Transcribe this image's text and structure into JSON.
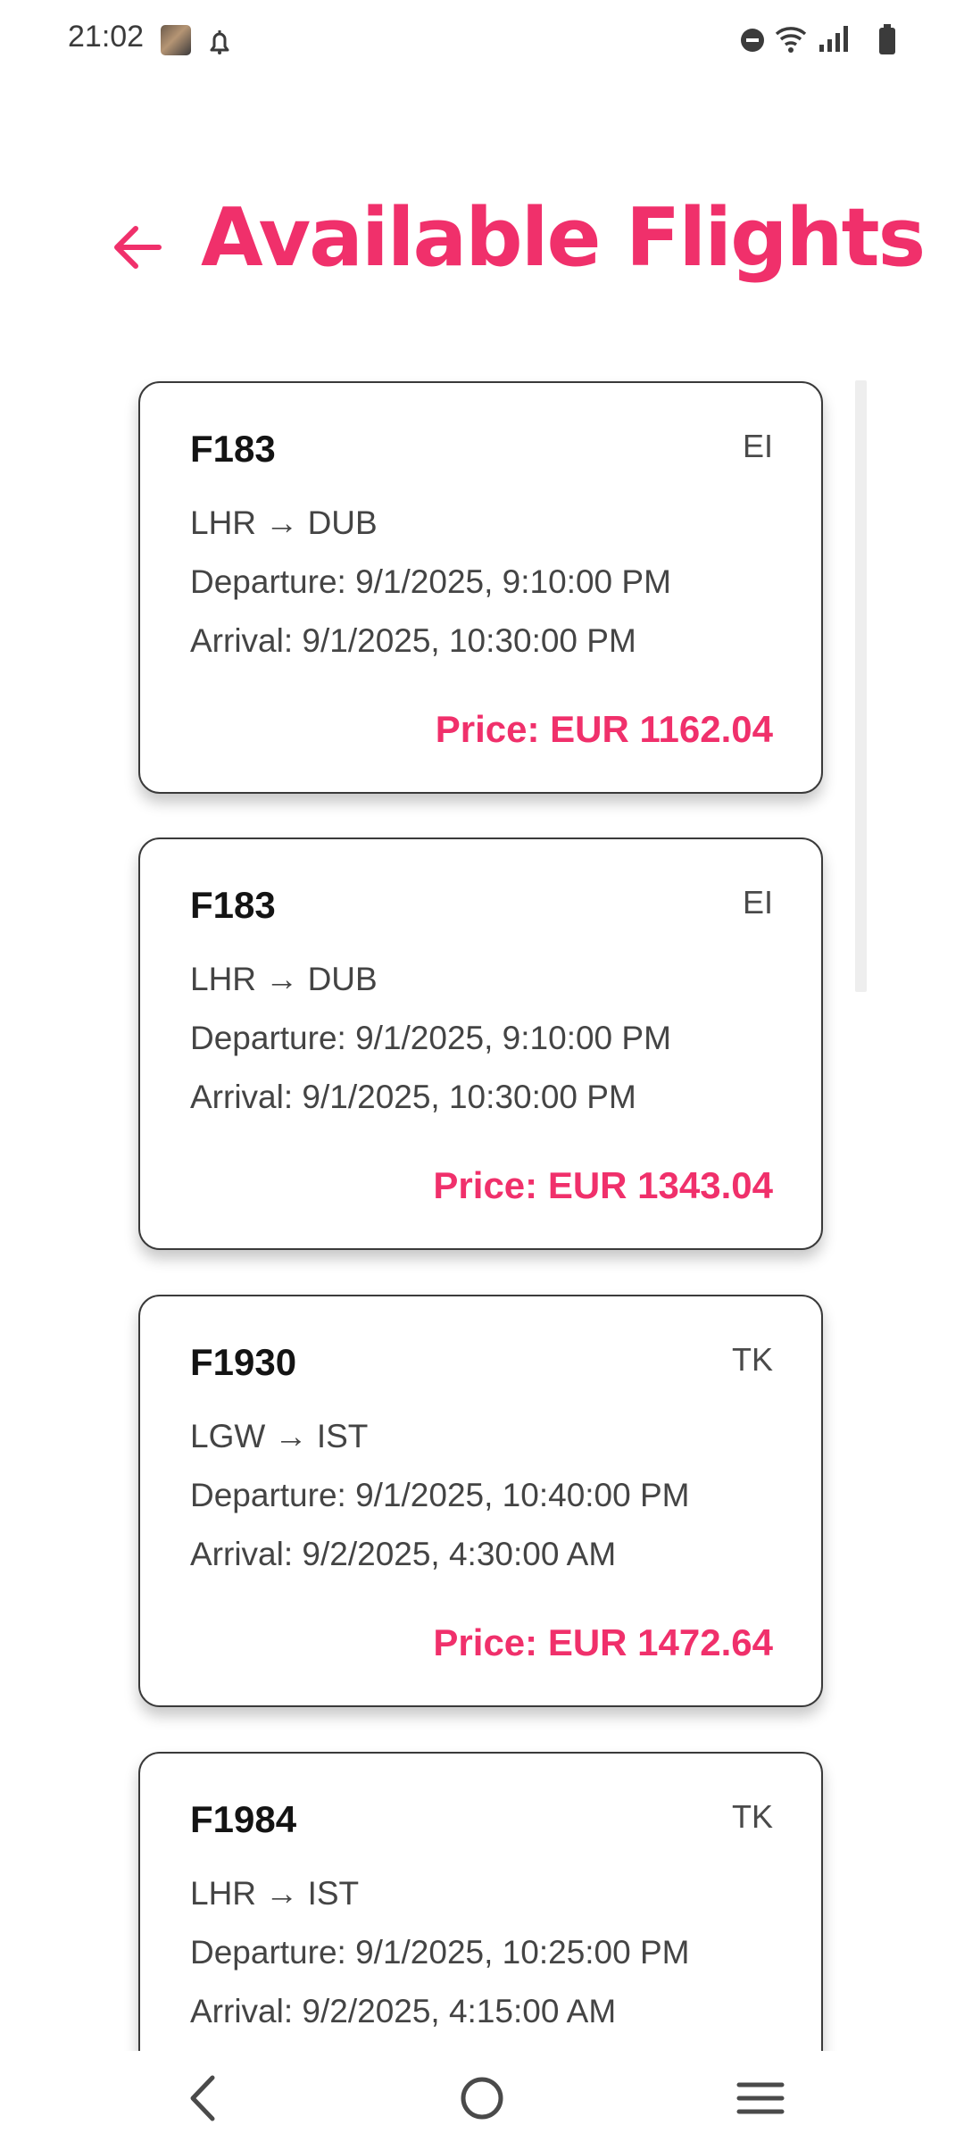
{
  "status_bar": {
    "time": "21:02",
    "icons": [
      "photo-notification-icon",
      "alarm-icon",
      "do-not-disturb-icon",
      "wifi-icon",
      "signal-icon",
      "battery-icon"
    ]
  },
  "header": {
    "back_icon": "arrow-left-icon",
    "title": "Available Flights"
  },
  "theme": {
    "accent": "#f0306b",
    "card_border": "#3a3a3a",
    "text": "#444444"
  },
  "flights": [
    {
      "flight_no": "F183",
      "airline": "EI",
      "route": "LHR → DUB",
      "departure": "Departure: 9/1/2025, 9:10:00 PM",
      "arrival": "Arrival: 9/1/2025, 10:30:00 PM",
      "price": "Price: EUR 1162.04"
    },
    {
      "flight_no": "F183",
      "airline": "EI",
      "route": "LHR → DUB",
      "departure": "Departure: 9/1/2025, 9:10:00 PM",
      "arrival": "Arrival: 9/1/2025, 10:30:00 PM",
      "price": "Price: EUR 1343.04"
    },
    {
      "flight_no": "F1930",
      "airline": "TK",
      "route": "LGW → IST",
      "departure": "Departure: 9/1/2025, 10:40:00 PM",
      "arrival": "Arrival: 9/2/2025, 4:30:00 AM",
      "price": "Price: EUR 1472.64"
    },
    {
      "flight_no": "F1984",
      "airline": "TK",
      "route": "LHR → IST",
      "departure": "Departure: 9/1/2025, 10:25:00 PM",
      "arrival": "Arrival: 9/2/2025, 4:15:00 AM",
      "price": ""
    }
  ],
  "nav_bar": {
    "icons": [
      "back-chevron-icon",
      "home-circle-icon",
      "recents-menu-icon"
    ]
  }
}
